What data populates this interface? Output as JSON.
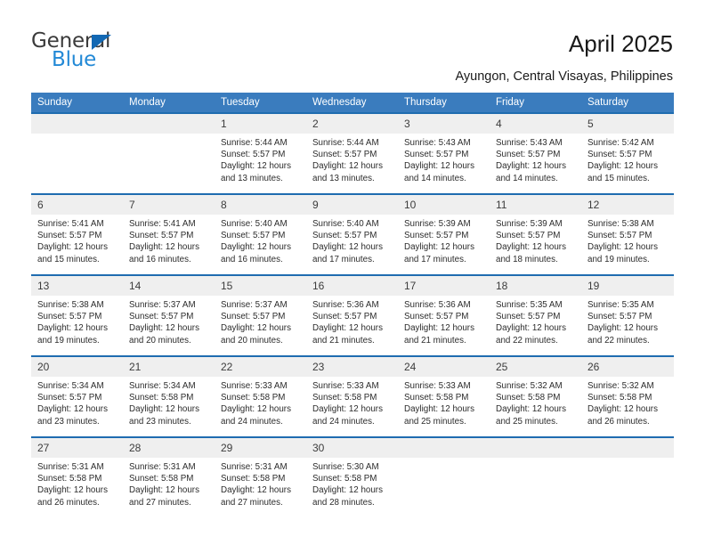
{
  "brand": {
    "name_part1": "General",
    "name_part2": "Blue",
    "accent_color": "#2389d6",
    "triangle_color": "#1268b3"
  },
  "header": {
    "title": "April 2025",
    "location": "Ayungon, Central Visayas, Philippines"
  },
  "theme": {
    "header_row_bg": "#3a7cbe",
    "week_separator": "#1f6cb0",
    "daynum_bg": "#efefef"
  },
  "weekday_headers": [
    "Sunday",
    "Monday",
    "Tuesday",
    "Wednesday",
    "Thursday",
    "Friday",
    "Saturday"
  ],
  "weeks": [
    {
      "days": [
        {
          "date": "",
          "sunrise": "",
          "sunset": "",
          "daylight_line1": "",
          "daylight_line2": ""
        },
        {
          "date": "",
          "sunrise": "",
          "sunset": "",
          "daylight_line1": "",
          "daylight_line2": ""
        },
        {
          "date": "1",
          "sunrise": "Sunrise: 5:44 AM",
          "sunset": "Sunset: 5:57 PM",
          "daylight_line1": "Daylight: 12 hours",
          "daylight_line2": "and 13 minutes."
        },
        {
          "date": "2",
          "sunrise": "Sunrise: 5:44 AM",
          "sunset": "Sunset: 5:57 PM",
          "daylight_line1": "Daylight: 12 hours",
          "daylight_line2": "and 13 minutes."
        },
        {
          "date": "3",
          "sunrise": "Sunrise: 5:43 AM",
          "sunset": "Sunset: 5:57 PM",
          "daylight_line1": "Daylight: 12 hours",
          "daylight_line2": "and 14 minutes."
        },
        {
          "date": "4",
          "sunrise": "Sunrise: 5:43 AM",
          "sunset": "Sunset: 5:57 PM",
          "daylight_line1": "Daylight: 12 hours",
          "daylight_line2": "and 14 minutes."
        },
        {
          "date": "5",
          "sunrise": "Sunrise: 5:42 AM",
          "sunset": "Sunset: 5:57 PM",
          "daylight_line1": "Daylight: 12 hours",
          "daylight_line2": "and 15 minutes."
        }
      ]
    },
    {
      "days": [
        {
          "date": "6",
          "sunrise": "Sunrise: 5:41 AM",
          "sunset": "Sunset: 5:57 PM",
          "daylight_line1": "Daylight: 12 hours",
          "daylight_line2": "and 15 minutes."
        },
        {
          "date": "7",
          "sunrise": "Sunrise: 5:41 AM",
          "sunset": "Sunset: 5:57 PM",
          "daylight_line1": "Daylight: 12 hours",
          "daylight_line2": "and 16 minutes."
        },
        {
          "date": "8",
          "sunrise": "Sunrise: 5:40 AM",
          "sunset": "Sunset: 5:57 PM",
          "daylight_line1": "Daylight: 12 hours",
          "daylight_line2": "and 16 minutes."
        },
        {
          "date": "9",
          "sunrise": "Sunrise: 5:40 AM",
          "sunset": "Sunset: 5:57 PM",
          "daylight_line1": "Daylight: 12 hours",
          "daylight_line2": "and 17 minutes."
        },
        {
          "date": "10",
          "sunrise": "Sunrise: 5:39 AM",
          "sunset": "Sunset: 5:57 PM",
          "daylight_line1": "Daylight: 12 hours",
          "daylight_line2": "and 17 minutes."
        },
        {
          "date": "11",
          "sunrise": "Sunrise: 5:39 AM",
          "sunset": "Sunset: 5:57 PM",
          "daylight_line1": "Daylight: 12 hours",
          "daylight_line2": "and 18 minutes."
        },
        {
          "date": "12",
          "sunrise": "Sunrise: 5:38 AM",
          "sunset": "Sunset: 5:57 PM",
          "daylight_line1": "Daylight: 12 hours",
          "daylight_line2": "and 19 minutes."
        }
      ]
    },
    {
      "days": [
        {
          "date": "13",
          "sunrise": "Sunrise: 5:38 AM",
          "sunset": "Sunset: 5:57 PM",
          "daylight_line1": "Daylight: 12 hours",
          "daylight_line2": "and 19 minutes."
        },
        {
          "date": "14",
          "sunrise": "Sunrise: 5:37 AM",
          "sunset": "Sunset: 5:57 PM",
          "daylight_line1": "Daylight: 12 hours",
          "daylight_line2": "and 20 minutes."
        },
        {
          "date": "15",
          "sunrise": "Sunrise: 5:37 AM",
          "sunset": "Sunset: 5:57 PM",
          "daylight_line1": "Daylight: 12 hours",
          "daylight_line2": "and 20 minutes."
        },
        {
          "date": "16",
          "sunrise": "Sunrise: 5:36 AM",
          "sunset": "Sunset: 5:57 PM",
          "daylight_line1": "Daylight: 12 hours",
          "daylight_line2": "and 21 minutes."
        },
        {
          "date": "17",
          "sunrise": "Sunrise: 5:36 AM",
          "sunset": "Sunset: 5:57 PM",
          "daylight_line1": "Daylight: 12 hours",
          "daylight_line2": "and 21 minutes."
        },
        {
          "date": "18",
          "sunrise": "Sunrise: 5:35 AM",
          "sunset": "Sunset: 5:57 PM",
          "daylight_line1": "Daylight: 12 hours",
          "daylight_line2": "and 22 minutes."
        },
        {
          "date": "19",
          "sunrise": "Sunrise: 5:35 AM",
          "sunset": "Sunset: 5:57 PM",
          "daylight_line1": "Daylight: 12 hours",
          "daylight_line2": "and 22 minutes."
        }
      ]
    },
    {
      "days": [
        {
          "date": "20",
          "sunrise": "Sunrise: 5:34 AM",
          "sunset": "Sunset: 5:57 PM",
          "daylight_line1": "Daylight: 12 hours",
          "daylight_line2": "and 23 minutes."
        },
        {
          "date": "21",
          "sunrise": "Sunrise: 5:34 AM",
          "sunset": "Sunset: 5:58 PM",
          "daylight_line1": "Daylight: 12 hours",
          "daylight_line2": "and 23 minutes."
        },
        {
          "date": "22",
          "sunrise": "Sunrise: 5:33 AM",
          "sunset": "Sunset: 5:58 PM",
          "daylight_line1": "Daylight: 12 hours",
          "daylight_line2": "and 24 minutes."
        },
        {
          "date": "23",
          "sunrise": "Sunrise: 5:33 AM",
          "sunset": "Sunset: 5:58 PM",
          "daylight_line1": "Daylight: 12 hours",
          "daylight_line2": "and 24 minutes."
        },
        {
          "date": "24",
          "sunrise": "Sunrise: 5:33 AM",
          "sunset": "Sunset: 5:58 PM",
          "daylight_line1": "Daylight: 12 hours",
          "daylight_line2": "and 25 minutes."
        },
        {
          "date": "25",
          "sunrise": "Sunrise: 5:32 AM",
          "sunset": "Sunset: 5:58 PM",
          "daylight_line1": "Daylight: 12 hours",
          "daylight_line2": "and 25 minutes."
        },
        {
          "date": "26",
          "sunrise": "Sunrise: 5:32 AM",
          "sunset": "Sunset: 5:58 PM",
          "daylight_line1": "Daylight: 12 hours",
          "daylight_line2": "and 26 minutes."
        }
      ]
    },
    {
      "days": [
        {
          "date": "27",
          "sunrise": "Sunrise: 5:31 AM",
          "sunset": "Sunset: 5:58 PM",
          "daylight_line1": "Daylight: 12 hours",
          "daylight_line2": "and 26 minutes."
        },
        {
          "date": "28",
          "sunrise": "Sunrise: 5:31 AM",
          "sunset": "Sunset: 5:58 PM",
          "daylight_line1": "Daylight: 12 hours",
          "daylight_line2": "and 27 minutes."
        },
        {
          "date": "29",
          "sunrise": "Sunrise: 5:31 AM",
          "sunset": "Sunset: 5:58 PM",
          "daylight_line1": "Daylight: 12 hours",
          "daylight_line2": "and 27 minutes."
        },
        {
          "date": "30",
          "sunrise": "Sunrise: 5:30 AM",
          "sunset": "Sunset: 5:58 PM",
          "daylight_line1": "Daylight: 12 hours",
          "daylight_line2": "and 28 minutes."
        },
        {
          "date": "",
          "sunrise": "",
          "sunset": "",
          "daylight_line1": "",
          "daylight_line2": ""
        },
        {
          "date": "",
          "sunrise": "",
          "sunset": "",
          "daylight_line1": "",
          "daylight_line2": ""
        },
        {
          "date": "",
          "sunrise": "",
          "sunset": "",
          "daylight_line1": "",
          "daylight_line2": ""
        }
      ]
    }
  ]
}
